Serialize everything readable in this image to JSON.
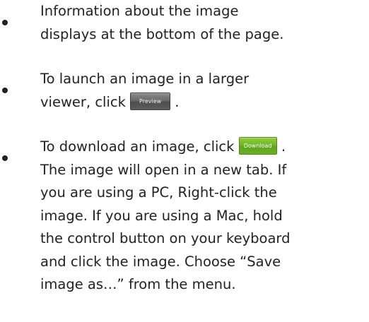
{
  "bullets": [
    {
      "lines": [
        "Information about the image",
        "displays at the bottom of the page."
      ]
    },
    {
      "line1": "To launch an image in a larger",
      "line2_before": "viewer, click",
      "button_label": "Preview",
      "line2_after": "."
    },
    {
      "line1_before": "To download an image, click",
      "button_label": "Download",
      "line1_after": ".",
      "lines": [
        "The image will open in a new tab. If",
        "you are using a PC, Right-click the",
        "image. If you are using a Mac, hold",
        "the control button on your keyboard",
        "and click the image.  Choose “Save",
        "image as…” from the menu."
      ]
    }
  ],
  "colors": {
    "text": "#222222",
    "preview_button": "#6a6a6a",
    "download_button": "#73b62a"
  }
}
